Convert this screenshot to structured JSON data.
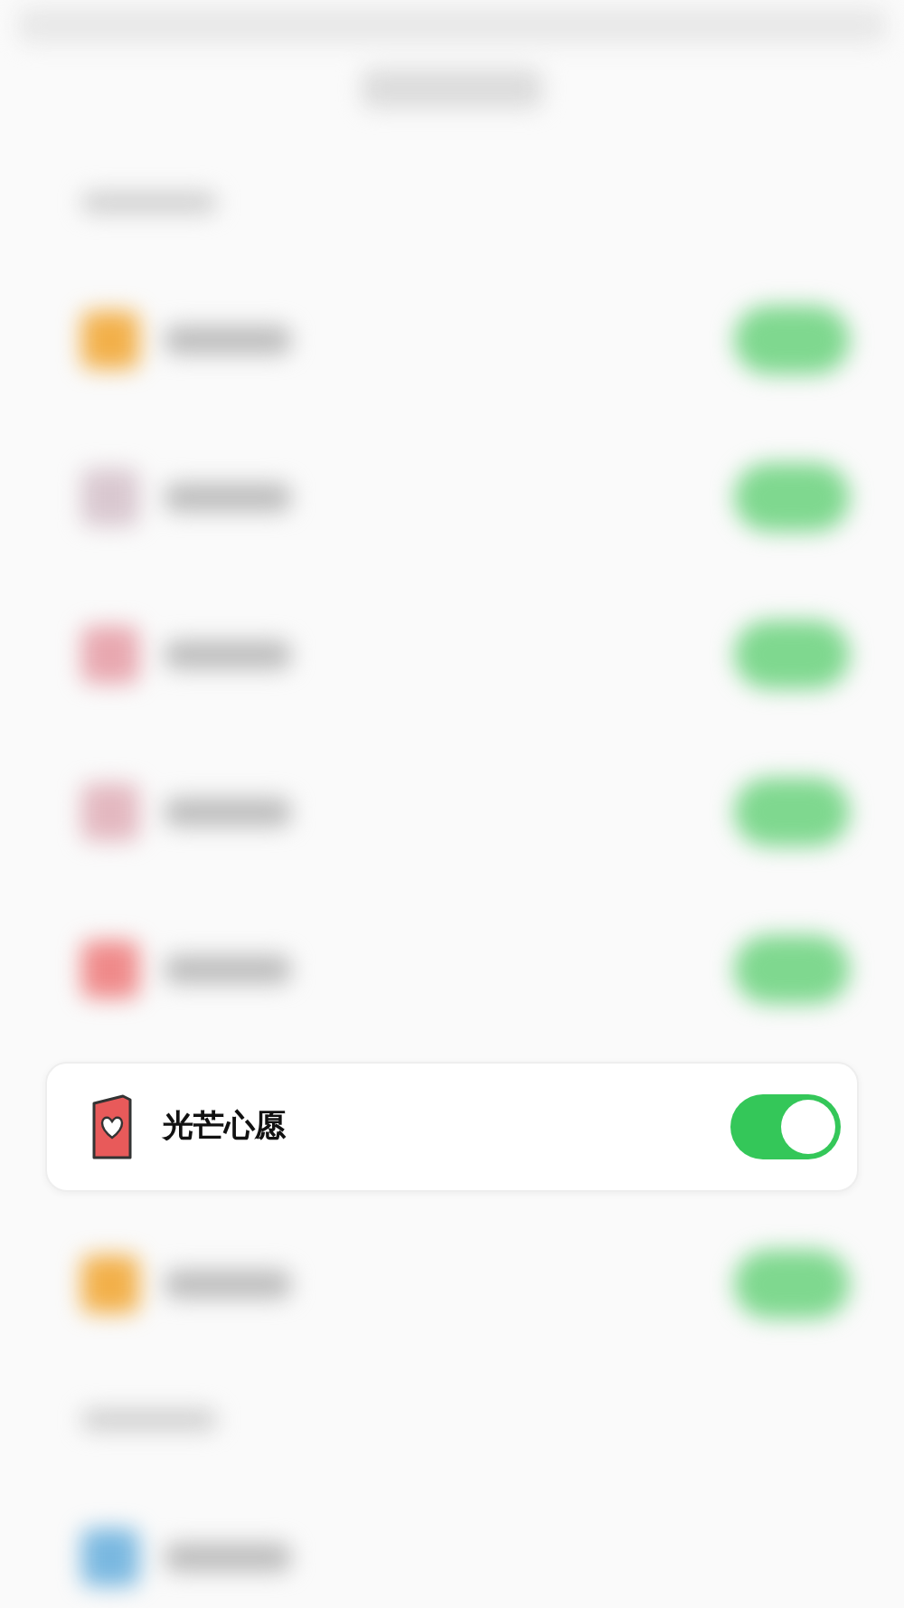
{
  "sections": [
    {
      "rows": [
        {
          "kind": "blurred",
          "color": "#f2b04a",
          "on": true
        },
        {
          "kind": "blurred",
          "color": "#d9c8d0",
          "on": true
        },
        {
          "kind": "blurred",
          "color": "#e8a8b0",
          "on": true
        },
        {
          "kind": "blurred",
          "color": "#e3b8c0",
          "on": true
        },
        {
          "kind": "blurred",
          "color": "#ef8a8a",
          "on": true
        },
        {
          "kind": "focused",
          "label": "光芒心愿",
          "on": true
        },
        {
          "kind": "blurred",
          "color": "#f2b04a",
          "on": true
        }
      ]
    },
    {
      "rows": [
        {
          "kind": "blurred",
          "color": "#7ab8e0"
        }
      ]
    }
  ]
}
